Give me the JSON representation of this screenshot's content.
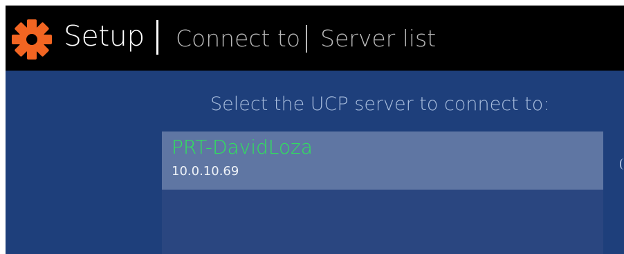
{
  "header": {
    "icon": "gear-icon",
    "title": "Setup",
    "breadcrumbs": [
      "Connect to",
      "Server list"
    ],
    "icon_color": "#f26522",
    "background": "#000000"
  },
  "main": {
    "prompt": "Select the UCP server to connect to:",
    "background": "#1e3f7b",
    "servers": [
      {
        "name": "PRT-DavidLoza",
        "address": "10.0.10.69",
        "name_color": "#2ee45b",
        "selected": true
      }
    ]
  }
}
